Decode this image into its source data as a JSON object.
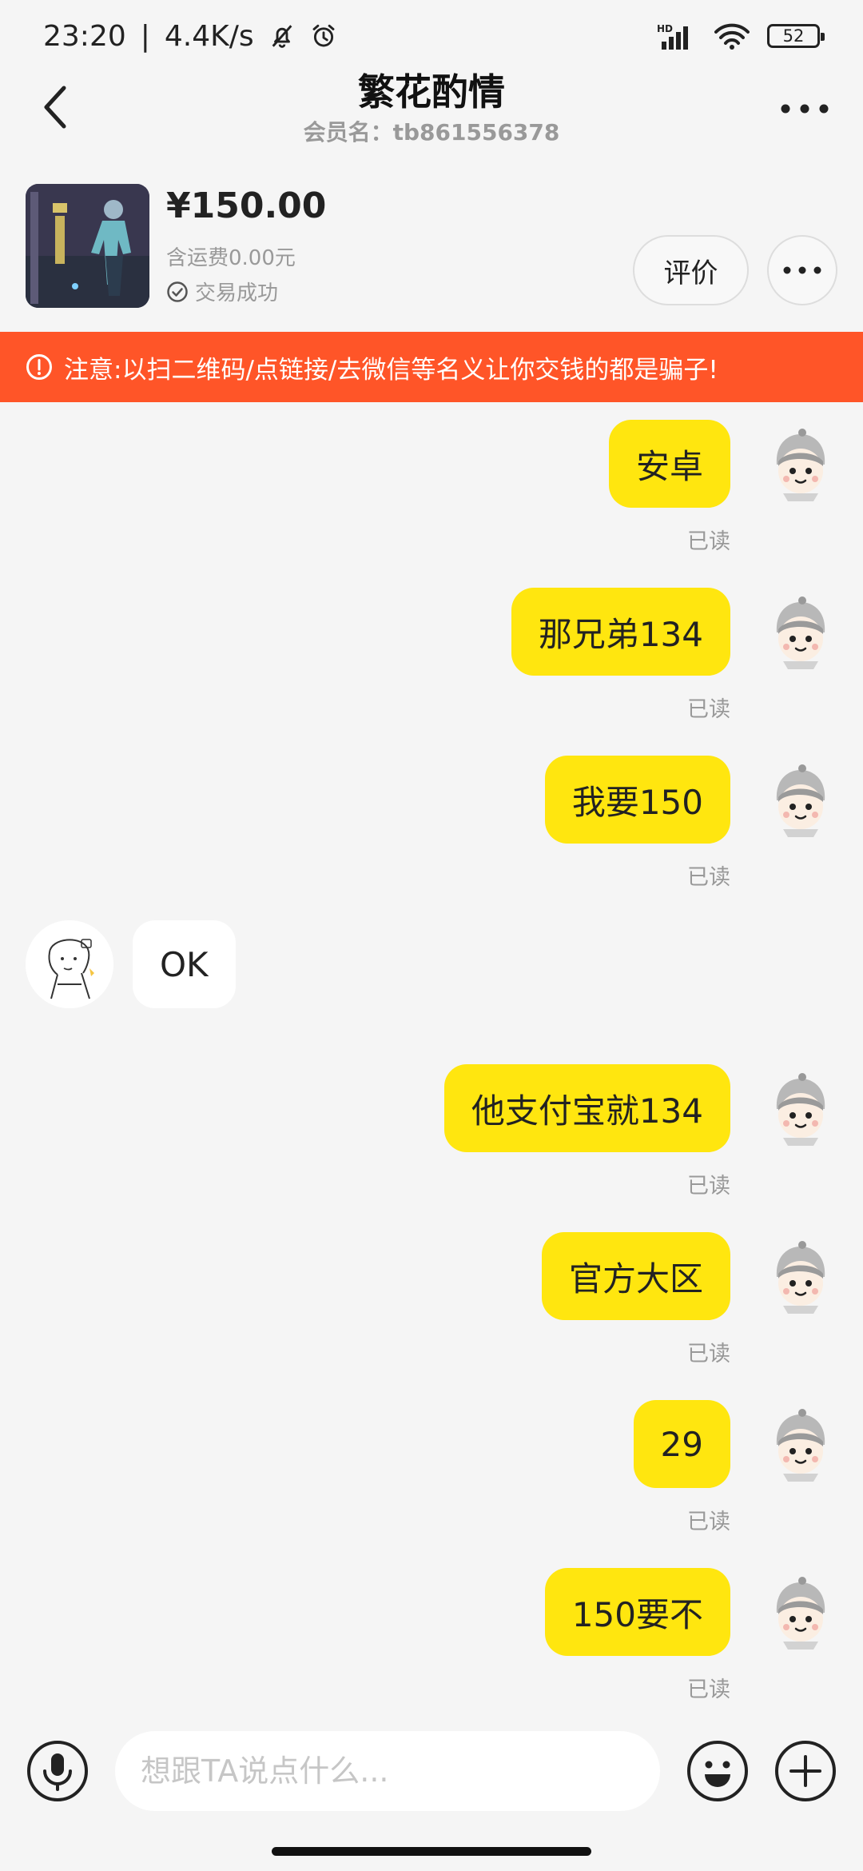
{
  "status_bar": {
    "time": "23:20",
    "net_speed": "4.4K/s",
    "signal_label": "HD",
    "battery": "52"
  },
  "header": {
    "title": "繁花酌情",
    "member_label": "会员名：tb861556378"
  },
  "product": {
    "price": "¥150.00",
    "shipping": "含运费0.00元",
    "status": "交易成功",
    "rate_label": "评价"
  },
  "warning": {
    "text": "注意:以扫二维码/点链接/去微信等名义让你交钱的都是骗子!"
  },
  "messages": [
    {
      "text": "安卓",
      "read": "已读"
    },
    {
      "text": "那兄弟134",
      "read": "已读"
    },
    {
      "text": "我要150",
      "read": "已读"
    },
    {
      "text": "OK"
    },
    {
      "text": "他支付宝就134",
      "read": "已读"
    },
    {
      "text": "官方大区",
      "read": "已读"
    },
    {
      "text": "29",
      "read": "已读"
    },
    {
      "text": "150要不",
      "read": "已读"
    }
  ],
  "input": {
    "placeholder": "想跟TA说点什么..."
  },
  "colors": {
    "bubble_out": "#ffe60f",
    "warning_bg": "#ff5528",
    "background": "#f5f5f5"
  },
  "icons": {
    "back": "chevron-left-icon",
    "more": "more-icon",
    "voice": "microphone-icon",
    "emoji": "emoji-icon",
    "plus": "plus-icon"
  }
}
